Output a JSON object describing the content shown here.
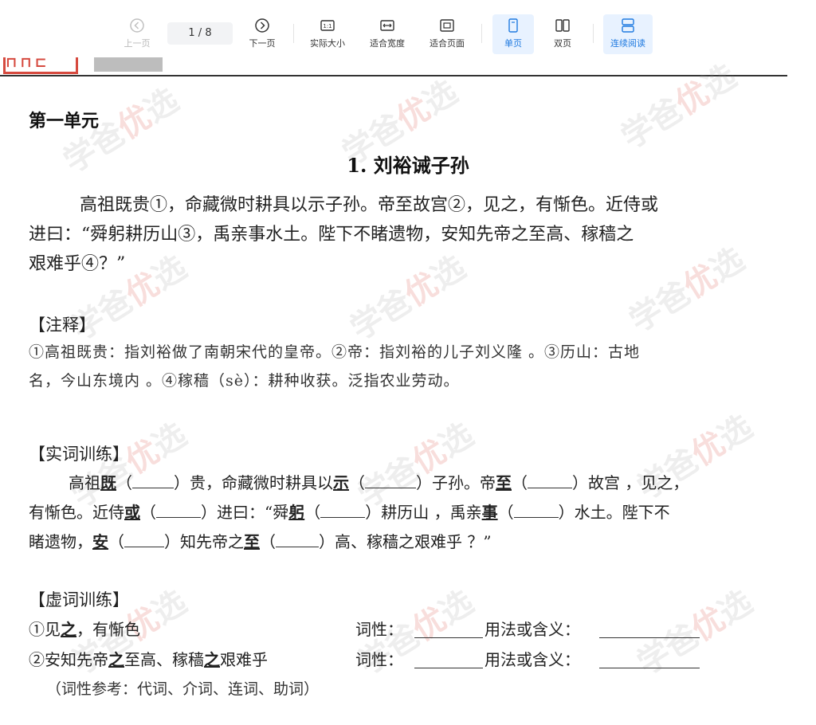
{
  "toolbar": {
    "prev_label": "上一页",
    "page_indicator": "1 / 8",
    "next_label": "下一页",
    "actual_size_label": "实际大小",
    "fit_width_label": "适合宽度",
    "fit_page_label": "适合页面",
    "single_page_label": "单页",
    "double_page_label": "双页",
    "continuous_label": "连续阅读",
    "accent_color": "#1f7ae0"
  },
  "document": {
    "unit_title": "第一单元",
    "lesson_title": "1. 刘裕诫子孙",
    "passage": {
      "line1": "高祖既贵①，命藏微时耕具以示子孙。帝至故宫②，见之，有惭色。近侍或",
      "line2": "进曰：“舜躬耕历山③，禹亲事水土。陛下不睹遗物，安知先帝之至高、稼穑之",
      "line3": "艰难乎④？”"
    },
    "notes": {
      "heading": "【注释】",
      "line1": "①高祖既贵：指刘裕做了南朝宋代的皇帝。②帝：指刘裕的儿子刘义隆 。③历山：古地",
      "line2": "名，今山东境内 。④稼穑（sè）：耕种收获。泛指农业劳动。"
    },
    "content_words": {
      "heading": "【实词训练】",
      "l1_a": "高祖",
      "l1_w1": "既",
      "l1_b": "贵，命藏微时耕具以",
      "l1_w2": "示",
      "l1_c": "子孙。帝",
      "l1_w3": "至",
      "l1_d": "故宫 ，见之，",
      "l2_a": "有惭色。近侍",
      "l2_w1": "或",
      "l2_b": "进曰：“舜",
      "l2_w2": "躬",
      "l2_c": "耕历山 ，禹亲",
      "l2_w3": "事",
      "l2_d": "水土。陛下不",
      "l3_a": "睹遗物，",
      "l3_w1": "安",
      "l3_b": "知先帝之",
      "l3_w2": "至",
      "l3_c": "高、稼穑之艰难乎 ？”",
      "paren_open": "（",
      "paren_close": "）"
    },
    "function_words": {
      "heading": "【虚词训练】",
      "q1_a": "①见",
      "q1_w": "之",
      "q1_b": "，有惭色",
      "q2_a": "②安知先帝",
      "q2_w1": "之",
      "q2_b": "至高、稼穑",
      "q2_w2": "之",
      "q2_c": "艰难乎",
      "pos_label": "词性：",
      "usage_label": "用法或含义：",
      "reference": "（词性参考：代词、介词、连词、助词）"
    }
  }
}
